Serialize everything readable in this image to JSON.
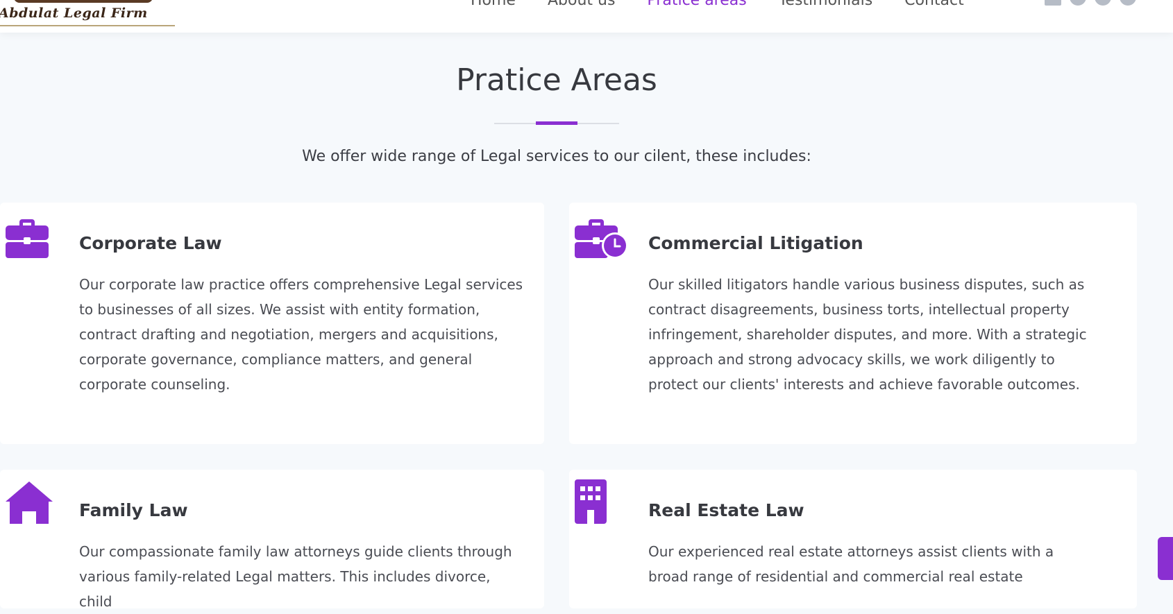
{
  "header": {
    "logo_text": "Abdulat Legal Firm",
    "nav": [
      {
        "label": "Home"
      },
      {
        "label": "About us"
      },
      {
        "label": "Pratice areas"
      },
      {
        "label": "Testimonials"
      },
      {
        "label": "Contact"
      }
    ],
    "active_nav": "Pratice areas",
    "socials": [
      "linkedin-icon",
      "github-icon",
      "twitter-icon",
      "facebook-icon"
    ]
  },
  "section": {
    "title": "Pratice Areas",
    "subtitle": "We offer wide range of Legal services to our cilent, these includes:"
  },
  "cards": [
    {
      "icon": "briefcase-icon",
      "title": "Corporate Law",
      "text": "Our corporate law practice offers comprehensive Legal services to businesses of all sizes. We assist with entity formation, contract drafting and negotiation, mergers and acquisitions, corporate governance, compliance matters, and general corporate counseling."
    },
    {
      "icon": "business-time-icon",
      "title": "Commercial Litigation",
      "text": "Our skilled litigators handle various business disputes, such as contract disagreements, business torts, intellectual property infringement, shareholder disputes, and more. With a strategic approach and strong advocacy skills, we work diligently to protect our clients' interests and achieve favorable outcomes."
    },
    {
      "icon": "home-icon",
      "title": "Family Law",
      "text": "Our compassionate family law attorneys guide clients through various family-related Legal matters. This includes divorce, child"
    },
    {
      "icon": "building-icon",
      "title": "Real Estate Law",
      "text": "Our experienced real estate attorneys assist clients with a broad range of residential and commercial real estate"
    }
  ],
  "colors": {
    "accent": "#8a2fd1",
    "background": "#f6f9fc",
    "heading": "#37393f",
    "body_text": "#4a4c53"
  }
}
